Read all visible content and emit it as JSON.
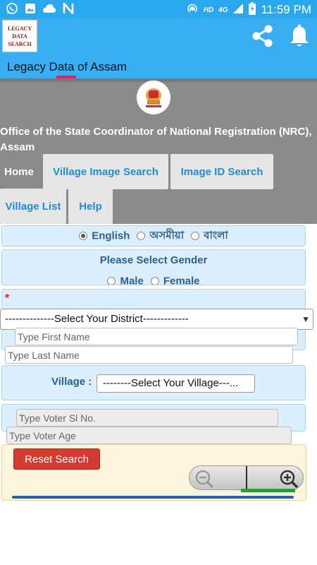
{
  "status_bar": {
    "network_label": "HD",
    "network_gen": "4G",
    "time": "11:59 PM",
    "icons": [
      "whatsapp-icon",
      "gallery-icon",
      "cloud-icon",
      "n-notification-icon",
      "hotspot-icon",
      "signal-icon",
      "battery-icon"
    ]
  },
  "app_bar": {
    "logo_lines": [
      "LEGACY",
      "DATA",
      "SEARCH"
    ],
    "tagline": "Legacy Data of  Assam",
    "accent_color": "#e91e63",
    "icons": [
      "share-icon",
      "bell-icon"
    ]
  },
  "header": {
    "emblem_icon": "state-emblem-icon",
    "office_title": "Office of the State Coordinator of National Registration (NRC), Assam",
    "tabs": [
      {
        "label": "Home",
        "active": true
      },
      {
        "label": "Village Image Search",
        "active": false
      },
      {
        "label": "Image ID Search",
        "active": false
      },
      {
        "label": "Village List",
        "active": false
      },
      {
        "label": "Help",
        "active": false
      }
    ]
  },
  "form": {
    "languages": [
      {
        "label": "English",
        "selected": true
      },
      {
        "label": "অসমীয়া",
        "selected": false
      },
      {
        "label": "বাংলা",
        "selected": false
      }
    ],
    "gender_prompt": "Please Select Gender",
    "genders": [
      {
        "label": "Male",
        "selected": false
      },
      {
        "label": "Female",
        "selected": false
      }
    ],
    "required_mark": "*",
    "district_select": "--------------Select Your District-------------",
    "first_name_placeholder": "Type First Name",
    "last_name_placeholder": "Type Last Name",
    "village_label": "Village :",
    "village_select": "--------Select Your Village---...",
    "voter_sl_placeholder": "Type Voter Sl No.",
    "voter_age_placeholder": "Type Voter Age",
    "reset_label": "Reset Search",
    "zoom_icons": [
      "zoom-out-icon",
      "zoom-in-icon"
    ]
  },
  "colors": {
    "status_bar": "#29a8f0",
    "app_bar": "#3aaef3",
    "header_grey": "#8b8b8b",
    "tab_text": "#1f8cd6",
    "panel_bg": "#dcefff",
    "reset_button": "#d43a2f"
  }
}
